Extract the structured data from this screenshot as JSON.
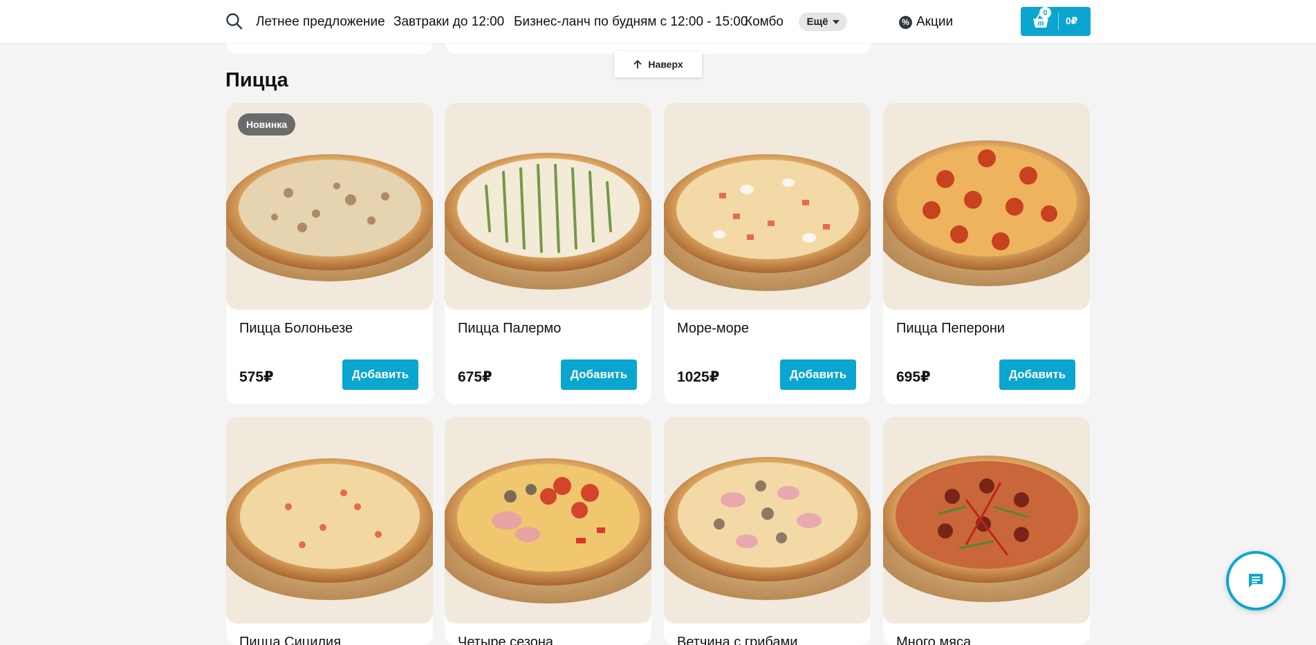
{
  "header": {
    "nav": [
      "Летнее предложение",
      "Завтраки до 12:00",
      "Бизнес-ланч по будням с 12:00 - 15:00",
      "Комбо"
    ],
    "more_label": "Ещё",
    "promo_label": "Акции",
    "cart_count": "0",
    "cart_total": "0₽"
  },
  "to_top_label": "Наверх",
  "section": {
    "title": "Пицца",
    "products": [
      {
        "name": "Пицца Болоньезе",
        "price": "575₽",
        "badge": "Новинка",
        "add_label": "Добавить"
      },
      {
        "name": "Пицца Палермо",
        "price": "675₽",
        "add_label": "Добавить"
      },
      {
        "name": "Море-море",
        "price": "1025₽",
        "add_label": "Добавить"
      },
      {
        "name": "Пицца Пеперони",
        "price": "695₽",
        "add_label": "Добавить"
      },
      {
        "name": "Пицца Сицилия"
      },
      {
        "name": "Четыре сезона"
      },
      {
        "name": "Ветчина с грибами"
      },
      {
        "name": "Много мяса"
      }
    ]
  },
  "colors": {
    "accent": "#0aa6cf",
    "page_bg": "#f4f4f4",
    "image_bg": "#f1e9dc"
  }
}
